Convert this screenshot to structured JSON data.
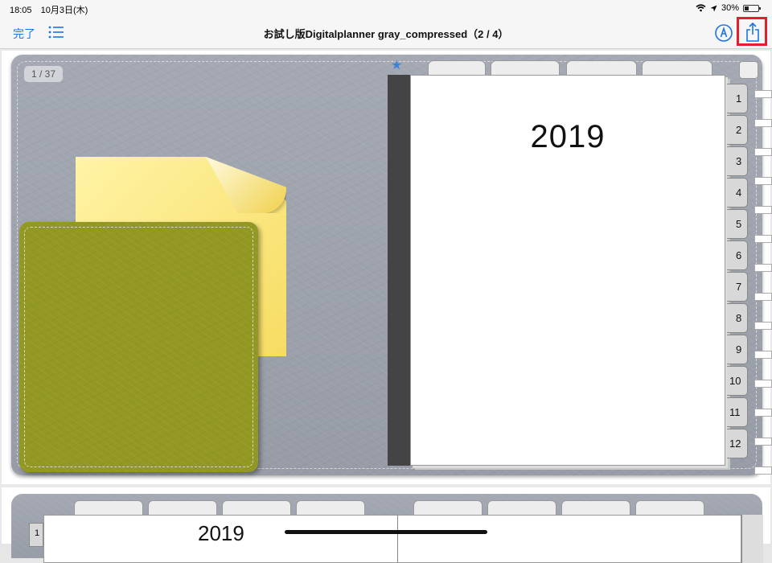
{
  "status_bar": {
    "time": "18:05",
    "date": "10月3日(木)",
    "battery_percent": "30%",
    "wifi_icon": "wifi-icon",
    "location_icon": "location-arrow-icon"
  },
  "nav_bar": {
    "done_label": "完了",
    "title": "お試し版Digitalplanner gray_compressed（2 / 4）",
    "list_icon": "list-icon",
    "markup_icon": "markup-pen-icon",
    "share_icon": "share-icon"
  },
  "page1": {
    "counter": "1 / 37",
    "year": "2019",
    "month_tabs": [
      "1",
      "2",
      "3",
      "4",
      "5",
      "6",
      "7",
      "8",
      "9",
      "10",
      "11",
      "12"
    ]
  },
  "page2": {
    "year": "2019",
    "side_tab": "1"
  },
  "colors": {
    "accent": "#1b74e4",
    "highlight": "#e31e2d",
    "cover": "#9ba0aa",
    "sticky": "#f7e27a"
  }
}
